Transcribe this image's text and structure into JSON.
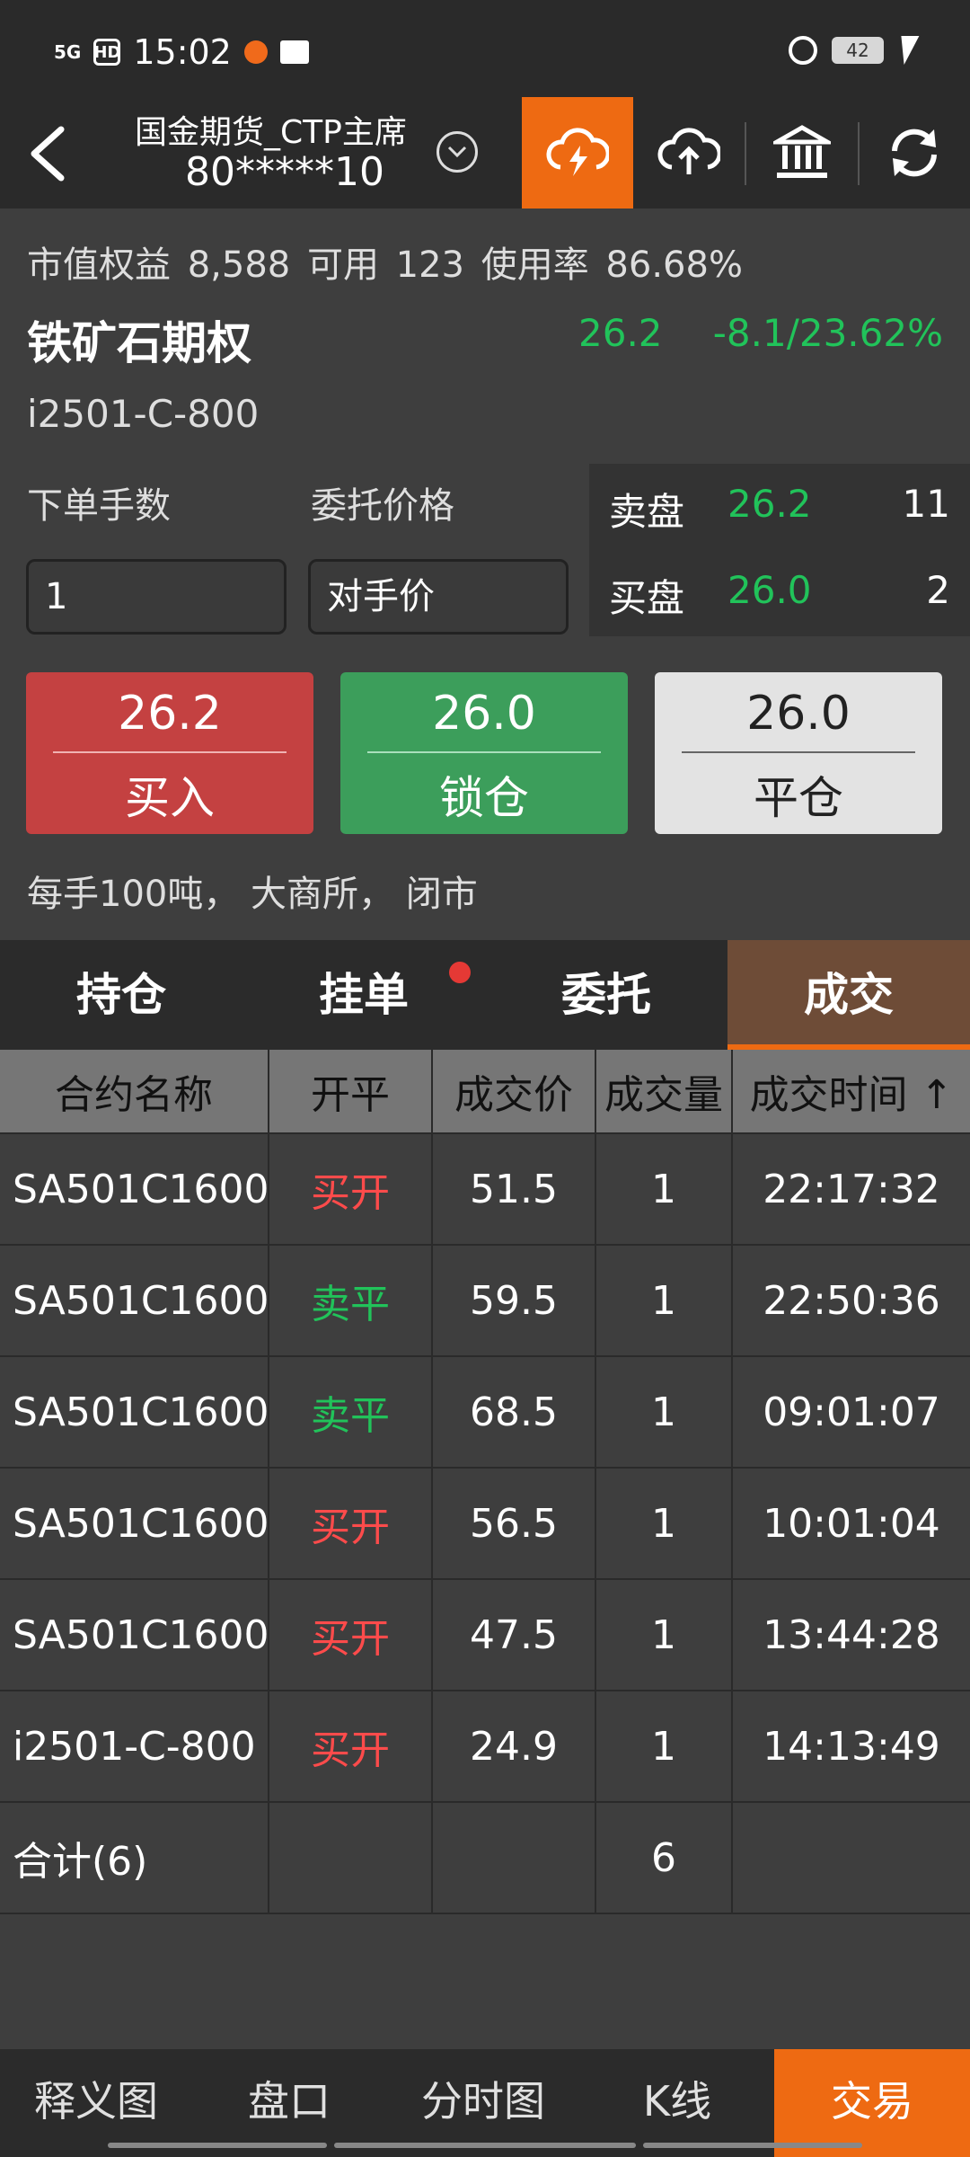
{
  "status": {
    "network": "5G",
    "hd": "HD",
    "time": "15:02",
    "battery": "42"
  },
  "nav": {
    "account_title": "国金期货_CTP主席",
    "account_number": "80*****10"
  },
  "summary": {
    "text": "市值权益 8,588   可用 123   使用率 86.68%"
  },
  "instrument": {
    "name": "铁矿石期权",
    "price": "26.2",
    "change": "-8.1/23.62%",
    "code": "i2501-C-800"
  },
  "order": {
    "qty_label": "下单手数",
    "price_label": "委托价格",
    "qty_value": "1",
    "price_value": "对手价"
  },
  "book": {
    "ask_label": "卖盘",
    "ask_price": "26.2",
    "ask_qty": "11",
    "bid_label": "买盘",
    "bid_price": "26.0",
    "bid_qty": "2"
  },
  "actions": {
    "buy": {
      "price": "26.2",
      "label": "买入"
    },
    "lock": {
      "price": "26.0",
      "label": "锁仓"
    },
    "close": {
      "price": "26.0",
      "label": "平仓"
    }
  },
  "note": "每手100吨，  大商所，  闭市",
  "tabs": [
    "持仓",
    "挂单",
    "委托",
    "成交"
  ],
  "table": {
    "headers": [
      "合约名称",
      "开平",
      "成交价",
      "成交量",
      "成交时间 ↑"
    ],
    "rows": [
      [
        "SA501C1600",
        "买开",
        "51.5",
        "1",
        "22:17:32"
      ],
      [
        "SA501C1600",
        "卖平",
        "59.5",
        "1",
        "22:50:36"
      ],
      [
        "SA501C1600",
        "卖平",
        "68.5",
        "1",
        "09:01:07"
      ],
      [
        "SA501C1600",
        "买开",
        "56.5",
        "1",
        "10:01:04"
      ],
      [
        "SA501C1600",
        "买开",
        "47.5",
        "1",
        "13:44:28"
      ],
      [
        "i2501-C-800",
        "买开",
        "24.9",
        "1",
        "14:13:49"
      ]
    ],
    "total_label": "合计(6)",
    "total_qty": "6"
  },
  "bottom_nav": [
    "释义图",
    "盘口",
    "分时图",
    "K线",
    "交易"
  ],
  "colors": {
    "accent": "#ee6a12",
    "up": "#ff4b4b",
    "down": "#21c35a",
    "buy": "#c44141",
    "lock": "#3c9e5b"
  }
}
